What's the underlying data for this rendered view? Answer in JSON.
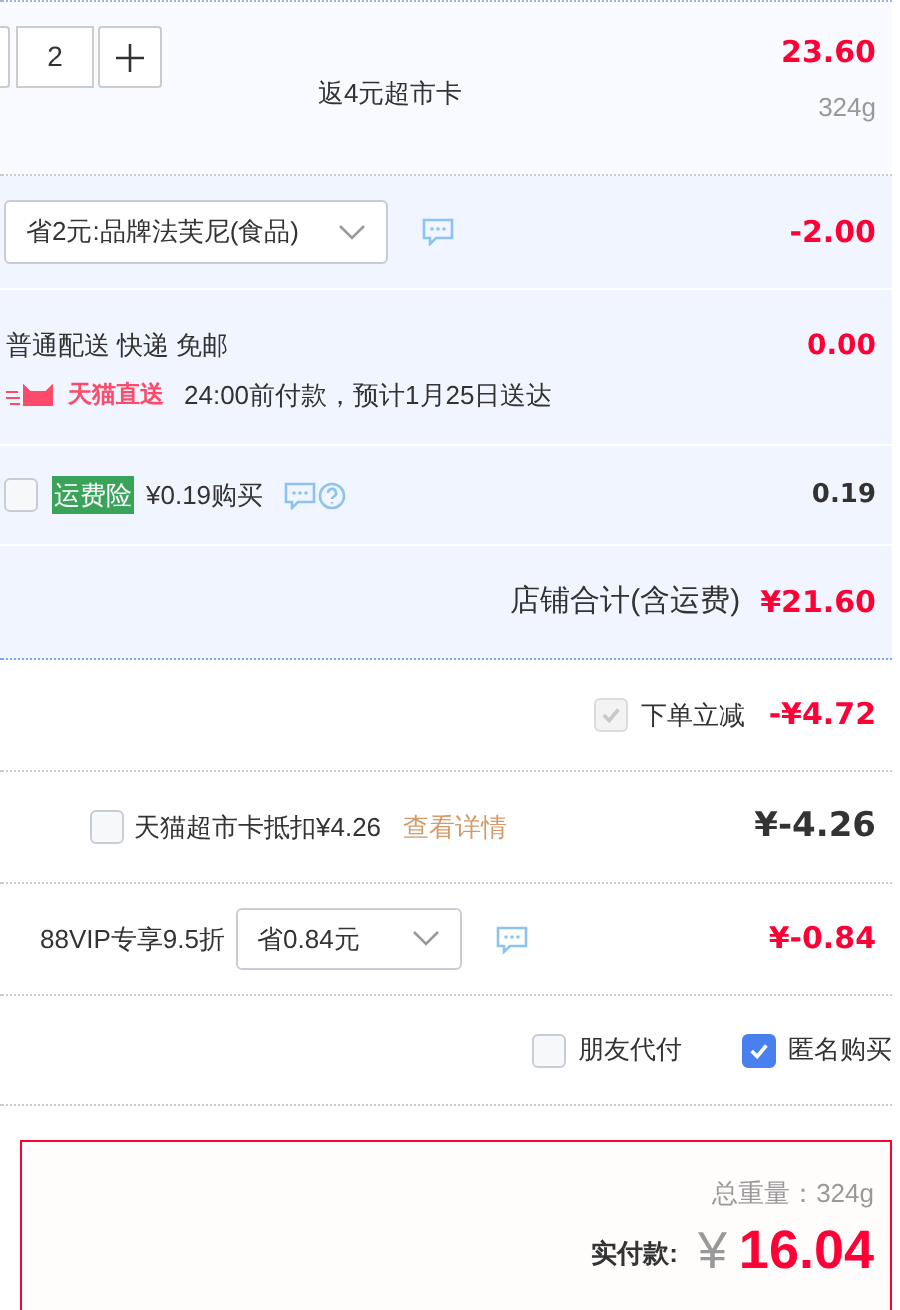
{
  "item": {
    "quantity": "2",
    "rebate": "返4元超市卡",
    "price": "23.60",
    "weight": "324g"
  },
  "promo": {
    "value": "省2元:品牌法芙尼(食品)",
    "amount": "-2.00"
  },
  "shipping": {
    "method": "普通配送 快递 免邮",
    "badge": "天猫直送",
    "eta": "24:00前付款，预计1月25日送达",
    "amount": "0.00"
  },
  "insurance": {
    "checked": false,
    "tag": "运费险",
    "text": "¥0.19购买",
    "amount": "0.19"
  },
  "shop_total": {
    "label": "店铺合计(含运费)",
    "amount": "¥21.60"
  },
  "instant_discount": {
    "checked": true,
    "disabled": true,
    "label": "下单立减",
    "amount": "-¥4.72"
  },
  "card_deduction": {
    "checked": false,
    "label": "天猫超市卡抵扣¥4.26",
    "link": "查看详情",
    "amount": "¥-4.26"
  },
  "vip": {
    "label": "88VIP专享9.5折",
    "value": "省0.84元",
    "amount": "¥-0.84"
  },
  "options": [
    {
      "label": "朋友代付",
      "checked": false
    },
    {
      "label": "匿名购买",
      "checked": true
    }
  ],
  "summary": {
    "weight": "总重量：324g",
    "pay_label": "实付款:",
    "currency": "¥",
    "total": "16.04"
  }
}
